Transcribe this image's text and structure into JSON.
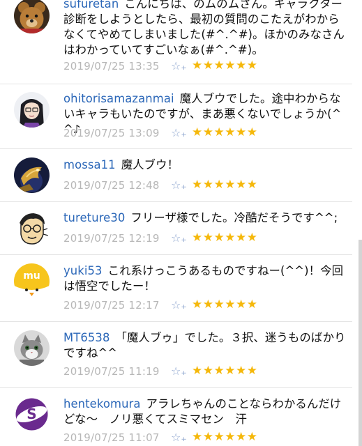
{
  "comments": [
    {
      "username": "sufuretan",
      "text": "こんにちは、のムのムさん。キャラクター診断をしようとしたら、最初の質問のこたえがわからなくてやめてしまいました(#^.^#)。ほかのみなさんはわかっていてすごいなぁ(#^.^#)。",
      "date": "2019/07/25 13:35",
      "fav_icon": "☆₊",
      "stars": "★★★★★★",
      "avatar": "teddy-bear"
    },
    {
      "username": "ohitorisamazanmai",
      "text": "魔人ブウでした。途中わからないキャラもいたのですが、まあ悪くないでしょうか(^^♪",
      "date": "2019/07/25 13:09",
      "fav_icon": "☆₊",
      "stars": "★★★★★★",
      "avatar": "anime-girl"
    },
    {
      "username": "mossa11",
      "text": "魔人ブウ！",
      "date": "2019/07/25 12:48",
      "fav_icon": "☆₊",
      "stars": "★★★★★★",
      "avatar": "golden-creature"
    },
    {
      "username": "tureture30",
      "text": "フリーザ様でした。冷酷だそうです^^;",
      "date": "2019/07/25 12:19",
      "fav_icon": "☆₊",
      "stars": "★★★★★★",
      "avatar": "cartoon-face"
    },
    {
      "username": "yuki53",
      "text": "これ系けっこうあるものですねー(^^)！今回は悟空でしたー！",
      "date": "2019/07/25 12:17",
      "fav_icon": "☆₊",
      "stars": "★★★★★★",
      "avatar": "yellow-chick"
    },
    {
      "username": "MT6538",
      "text": "「魔人ブゥ」でした。３択、迷うものばかりですね^^",
      "date": "2019/07/25 11:19",
      "fav_icon": "☆₊",
      "stars": "★★★★★★",
      "avatar": "cat"
    },
    {
      "username": "hentekomura",
      "text": "アラレちゃんのことならわかるんだけどな〜　ノリ悪くてスミマセン　汗",
      "date": "2019/07/25 11:07",
      "fav_icon": "☆₊",
      "stars": "★★★★★★",
      "avatar": "purple-logo"
    }
  ],
  "colors": {
    "username": "#2b67b8",
    "date": "#b7b7b7",
    "star": "#f5b80b",
    "fav": "#8ea6cf"
  }
}
